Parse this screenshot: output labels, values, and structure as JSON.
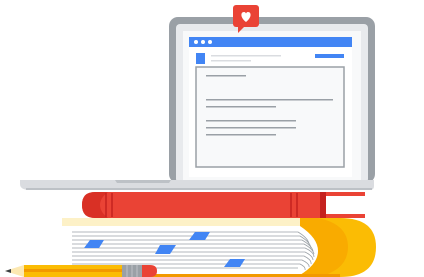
{
  "scene": {
    "subject": "laptop-on-stacked-books",
    "laptop": {
      "browser_window": {
        "control_dots": 3,
        "has_sidebar_marker": true
      },
      "notification_badge": {
        "icon": "heart-icon"
      }
    },
    "books": [
      {
        "name": "top-book",
        "cover_color": "#e53935"
      },
      {
        "name": "bottom-book",
        "cover_color": "#fbbc04"
      }
    ],
    "pencil": {
      "icon": "pencil-icon"
    }
  },
  "colors": {
    "accent_blue": "#4285f4",
    "laptop_frame": "#9aa0a6",
    "laptop_base": "#dadce0",
    "red": "#ea4335",
    "red_dark": "#c5221f",
    "yellow": "#fbbc04",
    "yellow_dark": "#f29900",
    "page_cream": "#fdf1c7",
    "screen_bg": "#f8f9fa"
  }
}
